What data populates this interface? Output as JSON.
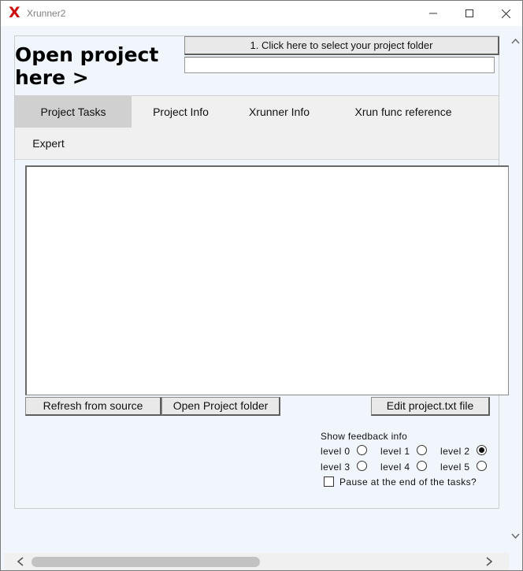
{
  "window": {
    "title": "Xrunner2",
    "app_icon": "X",
    "controls": [
      "minimize-icon",
      "maximize-icon",
      "close-icon"
    ]
  },
  "header": {
    "open_project_text": "Open project here >",
    "select_folder_label": "1. Click here to select your project folder",
    "folder_path_value": ""
  },
  "tabs": [
    {
      "label": "Project Tasks",
      "active": true
    },
    {
      "label": "Project Info",
      "active": false
    },
    {
      "label": "Xrunner Info",
      "active": false
    },
    {
      "label": "Xrun func reference",
      "active": false
    },
    {
      "label": "Expert",
      "active": false
    }
  ],
  "tasks": {
    "text": ""
  },
  "buttons": {
    "refresh": "Refresh from source",
    "open_folder": "Open Project folder",
    "edit_project": "Edit project.txt file"
  },
  "feedback": {
    "title": "Show feedback info",
    "levels": [
      {
        "label": "level 0",
        "checked": false
      },
      {
        "label": "level 1",
        "checked": false
      },
      {
        "label": "level 2",
        "checked": true
      },
      {
        "label": "level 3",
        "checked": false
      },
      {
        "label": "level 4",
        "checked": false
      },
      {
        "label": "level 5",
        "checked": false
      }
    ],
    "pause_label": "Pause at the end of the tasks?",
    "pause_checked": false
  },
  "colors": {
    "background": "#f0f6fc",
    "app_icon": "#cc1111",
    "active_tab": "#d0d0d0"
  }
}
